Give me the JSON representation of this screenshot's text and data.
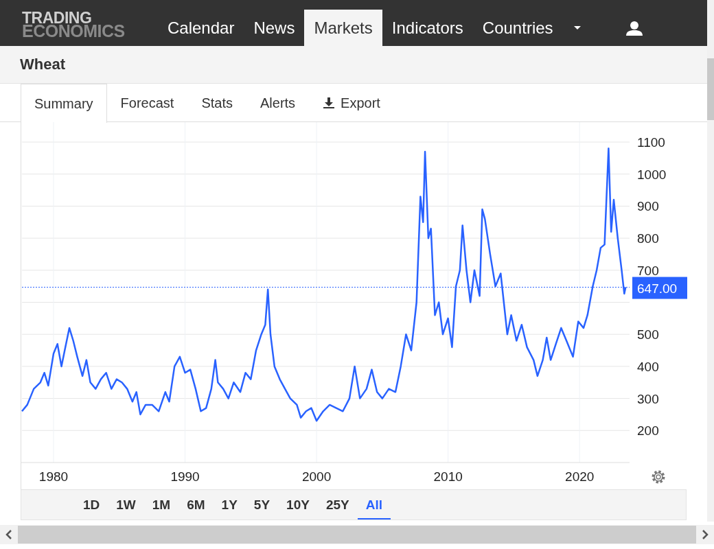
{
  "header": {
    "logo": [
      "TRADING",
      "ECONOMICS"
    ],
    "nav": [
      {
        "label": "Calendar",
        "selected": false
      },
      {
        "label": "News",
        "selected": false
      },
      {
        "label": "Markets",
        "selected": true
      },
      {
        "label": "Indicators",
        "selected": false
      },
      {
        "label": "Countries",
        "selected": false
      }
    ]
  },
  "title": "Wheat",
  "tabs": [
    {
      "label": "Summary",
      "selected": true,
      "kind": "tab"
    },
    {
      "label": "Forecast",
      "selected": false,
      "kind": "tab"
    },
    {
      "label": "Stats",
      "selected": false,
      "kind": "tab"
    },
    {
      "label": "Alerts",
      "selected": false,
      "kind": "tab"
    },
    {
      "label": "Export",
      "selected": false,
      "kind": "export"
    }
  ],
  "chart": {
    "chart_data": {
      "type": "line",
      "grid": true,
      "xlim": [
        1977.6,
        2023.8
      ],
      "ylim": [
        100,
        1100
      ],
      "xticks": [
        1980,
        1990,
        2000,
        2010,
        2020
      ],
      "yticks": [
        200,
        300,
        400,
        500,
        700,
        800,
        900,
        1000,
        1100
      ],
      "x": [
        1977.6,
        1978,
        1978.5,
        1979,
        1979.3,
        1979.6,
        1980,
        1980.3,
        1980.6,
        1980.9,
        1981.2,
        1981.5,
        1981.8,
        1982.2,
        1982.5,
        1982.8,
        1983.2,
        1983.6,
        1984,
        1984.4,
        1984.8,
        1985.2,
        1985.6,
        1986,
        1986.3,
        1986.6,
        1987,
        1987.5,
        1988,
        1988.5,
        1988.8,
        1989.2,
        1989.6,
        1990,
        1990.4,
        1990.8,
        1991.2,
        1991.6,
        1992,
        1992.3,
        1992.5,
        1992.9,
        1993.3,
        1993.7,
        1994.2,
        1994.6,
        1995,
        1995.4,
        1995.8,
        1996.1,
        1996.3,
        1996.5,
        1996.8,
        1997.2,
        1997.6,
        1998,
        1998.5,
        1998.8,
        1999.2,
        1999.6,
        2000,
        2000.5,
        2001,
        2001.5,
        2002,
        2002.5,
        2002.9,
        2003.3,
        2003.8,
        2004.2,
        2004.6,
        2005,
        2005.5,
        2006,
        2006.4,
        2006.8,
        2007.2,
        2007.6,
        2007.9,
        2008.1,
        2008.25,
        2008.5,
        2008.7,
        2009,
        2009.3,
        2009.6,
        2010,
        2010.3,
        2010.6,
        2010.9,
        2011.1,
        2011.4,
        2011.7,
        2012,
        2012.4,
        2012.6,
        2012.8,
        2013.2,
        2013.6,
        2014,
        2014.5,
        2014.8,
        2015.2,
        2015.6,
        2016,
        2016.5,
        2016.8,
        2017.2,
        2017.5,
        2017.8,
        2018.2,
        2018.6,
        2019,
        2019.5,
        2019.9,
        2020.3,
        2020.6,
        2021,
        2021.3,
        2021.6,
        2021.9,
        2022.2,
        2022.4,
        2022.6,
        2022.9,
        2023.2,
        2023.4,
        2023.5
      ],
      "series": [
        {
          "color": "#2962ff",
          "values": [
            260,
            280,
            330,
            350,
            380,
            340,
            440,
            470,
            400,
            460,
            520,
            480,
            430,
            370,
            420,
            350,
            330,
            360,
            380,
            330,
            360,
            350,
            330,
            290,
            320,
            250,
            280,
            280,
            260,
            320,
            290,
            400,
            430,
            380,
            390,
            330,
            260,
            270,
            330,
            420,
            350,
            330,
            300,
            350,
            320,
            380,
            360,
            450,
            500,
            530,
            640,
            500,
            400,
            360,
            330,
            300,
            280,
            240,
            260,
            270,
            230,
            260,
            280,
            270,
            260,
            300,
            400,
            300,
            330,
            390,
            320,
            300,
            330,
            320,
            400,
            500,
            450,
            600,
            930,
            850,
            1070,
            800,
            830,
            560,
            600,
            500,
            550,
            460,
            650,
            700,
            840,
            700,
            600,
            700,
            620,
            890,
            860,
            750,
            650,
            690,
            500,
            560,
            480,
            530,
            460,
            420,
            370,
            420,
            490,
            420,
            470,
            520,
            480,
            430,
            540,
            520,
            560,
            650,
            700,
            770,
            780,
            1080,
            820,
            920,
            800,
            700,
            627,
            647
          ]
        }
      ],
      "ref_lines": [
        {
          "axis": "y",
          "value": 647,
          "label": "647.00"
        }
      ]
    }
  },
  "ranges": [
    {
      "label": "1D",
      "selected": false
    },
    {
      "label": "1W",
      "selected": false
    },
    {
      "label": "1M",
      "selected": false
    },
    {
      "label": "6M",
      "selected": false
    },
    {
      "label": "1Y",
      "selected": false
    },
    {
      "label": "5Y",
      "selected": false
    },
    {
      "label": "10Y",
      "selected": false
    },
    {
      "label": "25Y",
      "selected": false
    },
    {
      "label": "All",
      "selected": true
    }
  ]
}
